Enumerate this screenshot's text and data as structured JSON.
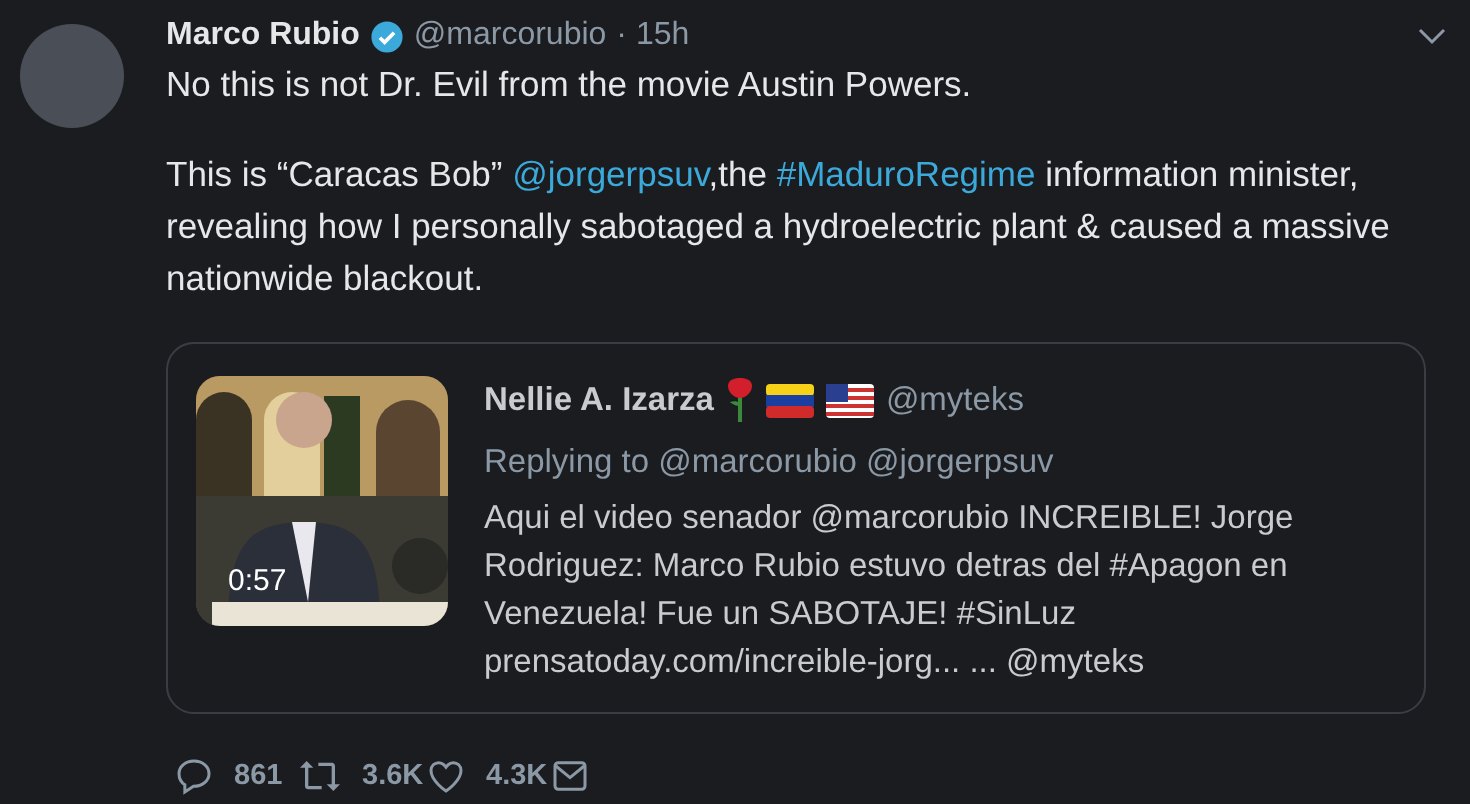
{
  "tweet": {
    "name": "Marco Rubio",
    "verified": true,
    "handle": "@marcorubio",
    "time": "· 15h",
    "paragraphs": [
      [
        {
          "kind": "text",
          "text": "No this is not Dr. Evil from the movie Austin Powers."
        }
      ],
      [
        {
          "kind": "text",
          "text": "This is “Caracas Bob” "
        },
        {
          "kind": "mention",
          "text": "@jorgerpsuv"
        },
        {
          "kind": "text",
          "text": ",the "
        },
        {
          "kind": "hashtag",
          "text": "#MaduroRegime"
        },
        {
          "kind": "text",
          "text": " information minister, revealing how I personally sabotaged a hydroelectric plant & caused a massive nationwide blackout."
        }
      ]
    ],
    "quote": {
      "name": "Nellie A. Izarza",
      "handle": "@myteks",
      "replying": "Replying to @marcorubio @jorgerpsuv",
      "text": "Aqui el video senador @marcorubio INCREIBLE! Jorge Rodriguez: Marco Rubio estuvo detras del #Apagon en Venezuela! Fue un SABOTAJE! #SinLuz prensatoday.com/increible-jorg... ... @myteks",
      "video": {
        "kind": "picture",
        "duration": "0:57"
      }
    },
    "actions": [
      {
        "kind": "reply",
        "count": "861"
      },
      {
        "kind": "retweet",
        "count": "3.6K"
      },
      {
        "kind": "like",
        "count": "4.3K"
      },
      {
        "kind": "message"
      }
    ]
  }
}
